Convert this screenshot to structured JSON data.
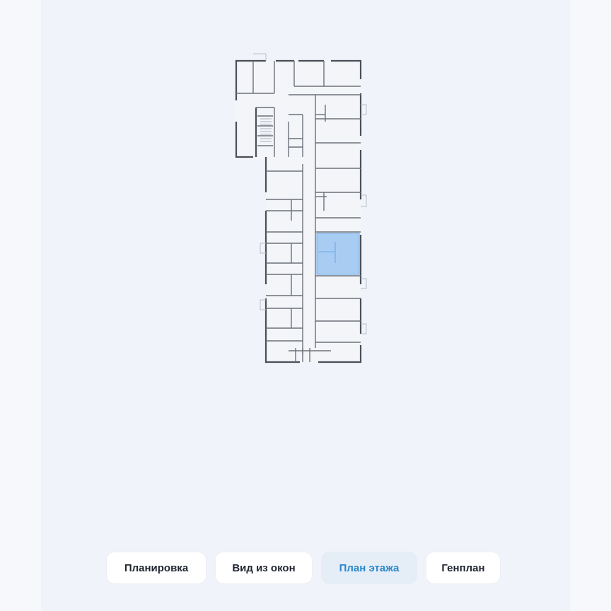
{
  "tabs": {
    "items": [
      {
        "label": "Планировка"
      },
      {
        "label": "Вид из окон"
      },
      {
        "label": "План этажа"
      },
      {
        "label": "Генплан"
      }
    ],
    "active_index": 2
  },
  "colors": {
    "background": "#f1f3fa",
    "accent": "#2b86c8",
    "highlight_unit": "#a9cdf2",
    "wall": "#4b4f57"
  },
  "floor_plan": {
    "highlighted_unit": "selected-apartment"
  }
}
